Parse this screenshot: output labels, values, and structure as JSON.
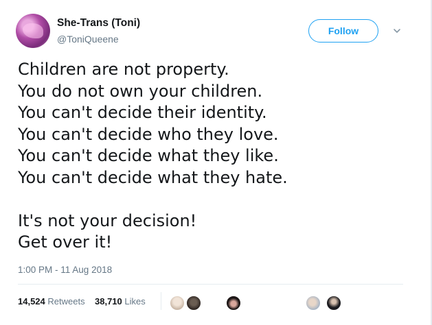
{
  "user": {
    "display_name": "She-Trans (Toni)",
    "handle": "@ToniQueene"
  },
  "actions": {
    "follow_label": "Follow",
    "menu_icon": "chevron-down-icon"
  },
  "tweet": {
    "lines": [
      "Children are not property.",
      "You do not own your children.",
      "You can't decide their identity.",
      "You can't decide who they love.",
      "You can't decide what they like.",
      "You can't decide what they hate.",
      "",
      "It's not your decision!",
      "Get over it!"
    ],
    "timestamp": "1:00 PM - 11 Aug 2018"
  },
  "stats": {
    "retweets_count": "14,524",
    "retweets_label": "Retweets",
    "likes_count": "38,710",
    "likes_label": "Likes"
  },
  "colors": {
    "accent": "#1da1f2",
    "text": "#14171a",
    "muted": "#657786"
  }
}
